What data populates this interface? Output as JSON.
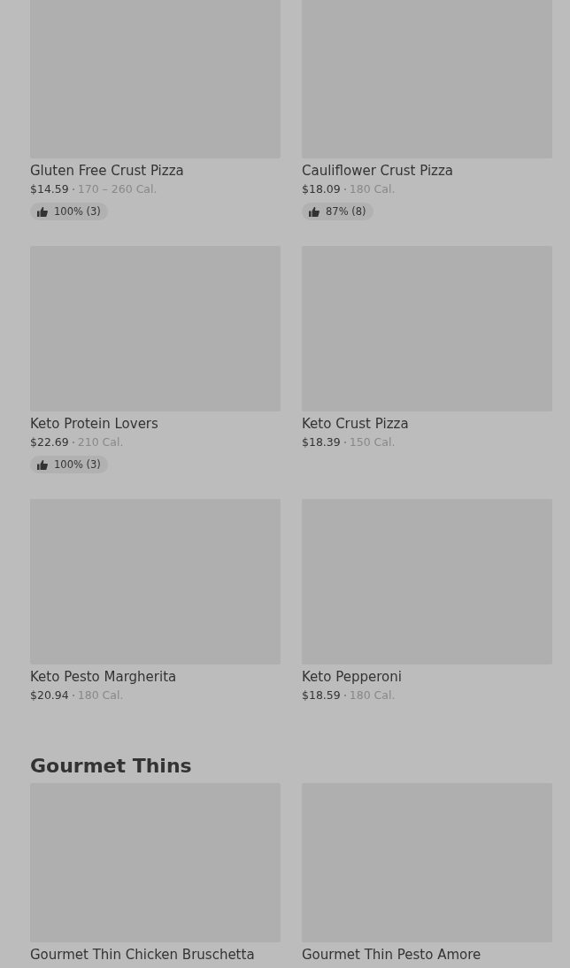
{
  "sections": [
    {
      "items": [
        {
          "name": "Gluten Free Crust Pizza",
          "price": "$14.59",
          "calories": "170 – 260 Cal.",
          "rating": "100% (3)"
        },
        {
          "name": "Cauliflower Crust Pizza",
          "price": "$18.09",
          "calories": "180 Cal.",
          "rating": "87% (8)"
        },
        {
          "name": "Keto Protein Lovers",
          "price": "$22.69",
          "calories": "210 Cal.",
          "rating": "100% (3)"
        },
        {
          "name": "Keto Crust Pizza",
          "price": "$18.39",
          "calories": "150 Cal."
        },
        {
          "name": "Keto Pesto Margherita",
          "price": "$20.94",
          "calories": "180 Cal."
        },
        {
          "name": "Keto Pepperoni",
          "price": "$18.59",
          "calories": "180 Cal."
        }
      ]
    },
    {
      "title": "Gourmet Thins",
      "items": [
        {
          "name": "Gourmet Thin Chicken Bruschetta"
        },
        {
          "name": "Gourmet Thin Pesto Amore"
        }
      ]
    }
  ]
}
